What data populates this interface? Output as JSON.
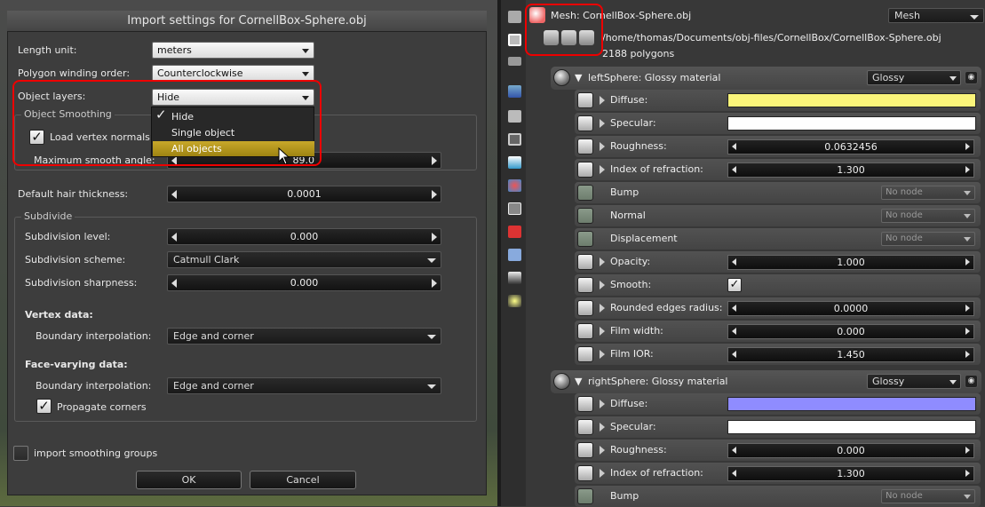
{
  "dialog": {
    "title": "Import settings for CornellBox-Sphere.obj",
    "length_unit_label": "Length unit:",
    "length_unit_value": "meters",
    "winding_label": "Polygon winding order:",
    "winding_value": "Counterclockwise",
    "object_layers_label": "Object layers:",
    "object_layers_value": "Hide",
    "object_layers_options": [
      "Hide",
      "Single object",
      "All objects"
    ],
    "smoothing_group_title": "Object Smoothing",
    "load_normals_label": "Load vertex normals",
    "load_normals_checked": true,
    "max_smooth_label": "Maximum smooth angle:",
    "max_smooth_value": "89.0",
    "hair_label": "Default hair thickness:",
    "hair_value": "0.0001",
    "subdivide_title": "Subdivide",
    "subdiv_level_label": "Subdivision level:",
    "subdiv_level_value": "0.000",
    "subdiv_scheme_label": "Subdivision scheme:",
    "subdiv_scheme_value": "Catmull Clark",
    "subdiv_sharp_label": "Subdivision sharpness:",
    "subdiv_sharp_value": "0.000",
    "vertex_data_title": "Vertex data:",
    "vertex_boundary_label": "Boundary interpolation:",
    "vertex_boundary_value": "Edge and corner",
    "face_data_title": "Face-varying data:",
    "face_boundary_label": "Boundary interpolation:",
    "face_boundary_value": "Edge and corner",
    "propagate_label": "Propagate corners",
    "propagate_checked": true,
    "import_groups_label": "import smoothing groups",
    "import_groups_checked": false,
    "ok_label": "OK",
    "cancel_label": "Cancel",
    "check_mark": "✓"
  },
  "mesh": {
    "title": "Mesh: CornellBox-Sphere.obj",
    "type_value": "Mesh",
    "path": "/home/thomas/Documents/obj-files/CornellBox/CornellBox-Sphere.obj",
    "polygons": "2188 polygons"
  },
  "materials": [
    {
      "header": "leftSphere: Glossy material",
      "type": "Glossy",
      "rows": [
        {
          "label": "Diffuse:",
          "kind": "color",
          "color": "#fbf57a"
        },
        {
          "label": "Specular:",
          "kind": "color",
          "color": "#ffffff"
        },
        {
          "label": "Roughness:",
          "kind": "slider",
          "value": "0.0632456"
        },
        {
          "label": "Index of refraction:",
          "kind": "slider",
          "value": "1.300"
        },
        {
          "label": "Bump",
          "kind": "node",
          "value": "No node"
        },
        {
          "label": "Normal",
          "kind": "node",
          "value": "No node"
        },
        {
          "label": "Displacement",
          "kind": "node",
          "value": "No node"
        },
        {
          "label": "Opacity:",
          "kind": "slider",
          "value": "1.000"
        },
        {
          "label": "Smooth:",
          "kind": "check",
          "value": "✓"
        },
        {
          "label": "Rounded edges radius:",
          "kind": "slider",
          "value": "0.0000"
        },
        {
          "label": "Film width:",
          "kind": "slider",
          "value": "0.000"
        },
        {
          "label": "Film IOR:",
          "kind": "slider",
          "value": "1.450"
        }
      ]
    },
    {
      "header": "rightSphere: Glossy material",
      "type": "Glossy",
      "rows": [
        {
          "label": "Diffuse:",
          "kind": "color",
          "color": "#8f8cff"
        },
        {
          "label": "Specular:",
          "kind": "color",
          "color": "#ffffff"
        },
        {
          "label": "Roughness:",
          "kind": "slider",
          "value": "0.000"
        },
        {
          "label": "Index of refraction:",
          "kind": "slider",
          "value": "1.300"
        },
        {
          "label": "Bump",
          "kind": "node",
          "value": "No node"
        }
      ]
    }
  ],
  "colors": {
    "highlight_red": "#e00000",
    "selected_option": "#b89a1a"
  }
}
